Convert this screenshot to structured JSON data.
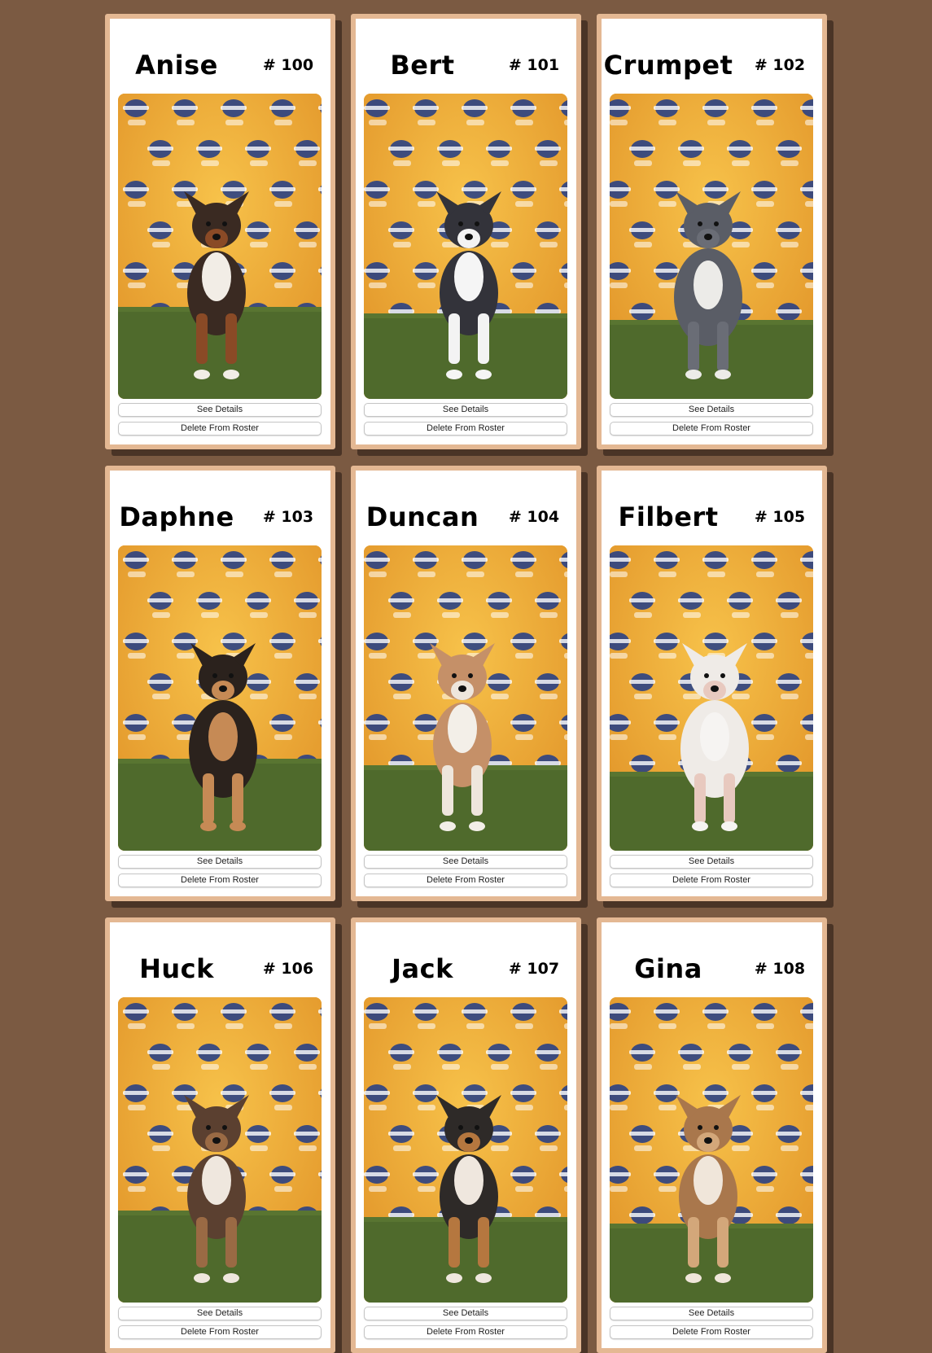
{
  "buttons": {
    "details_label": "See Details",
    "delete_label": "Delete From Roster"
  },
  "puppies": [
    {
      "name": "Anise",
      "number": "# 100",
      "photo_icon": "puppy-photo",
      "coat": "#3a2a22",
      "accent": "#8a4a26",
      "chest": "#f2ede6"
    },
    {
      "name": "Bert",
      "number": "# 101",
      "photo_icon": "puppy-photo",
      "coat": "#33333a",
      "accent": "#f3f3f3",
      "chest": "#f5f5f5"
    },
    {
      "name": "Crumpet",
      "number": "# 102",
      "photo_icon": "puppy-photo",
      "coat": "#5a5d66",
      "accent": "#6a6d76",
      "chest": "#ecebe8"
    },
    {
      "name": "Daphne",
      "number": "# 103",
      "photo_icon": "puppy-photo",
      "coat": "#2b221d",
      "accent": "#c68a55",
      "chest": "#c68a55"
    },
    {
      "name": "Duncan",
      "number": "# 104",
      "photo_icon": "puppy-photo",
      "coat": "#c59068",
      "accent": "#eee6dc",
      "chest": "#f3efe8"
    },
    {
      "name": "Filbert",
      "number": "# 105",
      "photo_icon": "puppy-photo",
      "coat": "#efebe7",
      "accent": "#e8c9bf",
      "chest": "#f6f4f2"
    },
    {
      "name": "Huck",
      "number": "# 106",
      "photo_icon": "puppy-photo",
      "coat": "#5b4030",
      "accent": "#9a6a44",
      "chest": "#efe7de"
    },
    {
      "name": "Jack",
      "number": "# 107",
      "photo_icon": "puppy-photo",
      "coat": "#2e2a28",
      "accent": "#b5773f",
      "chest": "#efe7de"
    },
    {
      "name": "Gina",
      "number": "# 108",
      "photo_icon": "puppy-photo",
      "coat": "#a9774c",
      "accent": "#d3a77a",
      "chest": "#f0e6da"
    }
  ],
  "colors": {
    "page_background": "#7b5a42",
    "card_border": "#e4b893",
    "card_shadow": "#4a3426",
    "backdrop": "#f0ad2e",
    "grass": "#4f6a2c",
    "logo_blue": "#1f3b8a"
  }
}
